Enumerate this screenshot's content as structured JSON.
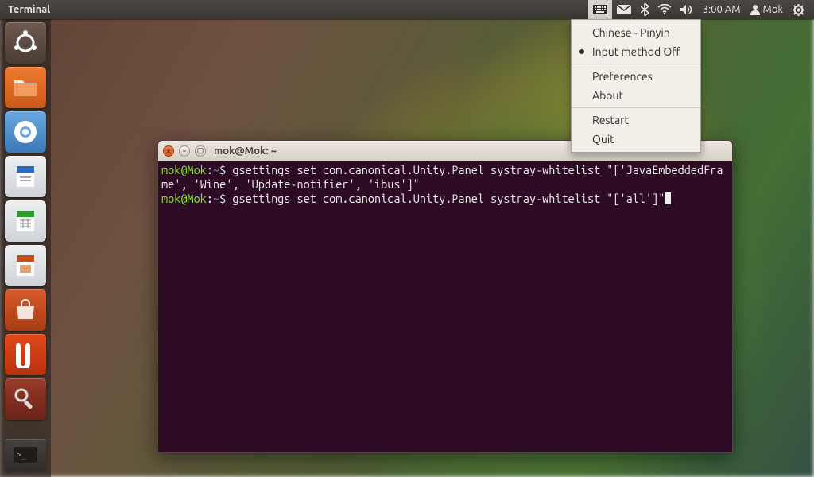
{
  "panel": {
    "app_label": "Terminal",
    "time": "3:00 AM",
    "user_name": "Mok"
  },
  "ibus_menu": {
    "items": [
      {
        "label": "Chinese - Pinyin",
        "selected": false
      },
      {
        "label": "Input method Off",
        "selected": true
      }
    ],
    "preferences": "Preferences",
    "about": "About",
    "restart": "Restart",
    "quit": "Quit"
  },
  "launcher": {
    "items": [
      "dash",
      "files",
      "browser",
      "writer",
      "calc",
      "impress",
      "software-center",
      "ubuntu-one",
      "settings",
      "terminal"
    ]
  },
  "terminal": {
    "window_title": "mok@Mok: ~",
    "prompt_user": "mok@Mok",
    "prompt_path": "~",
    "prompt_symbol": "$",
    "lines": [
      "gsettings set com.canonical.Unity.Panel systray-whitelist \"['JavaEmbeddedFrame', 'Wine', 'Update-notifier', 'ibus']\"",
      "gsettings set com.canonical.Unity.Panel systray-whitelist \"['all']\""
    ]
  }
}
